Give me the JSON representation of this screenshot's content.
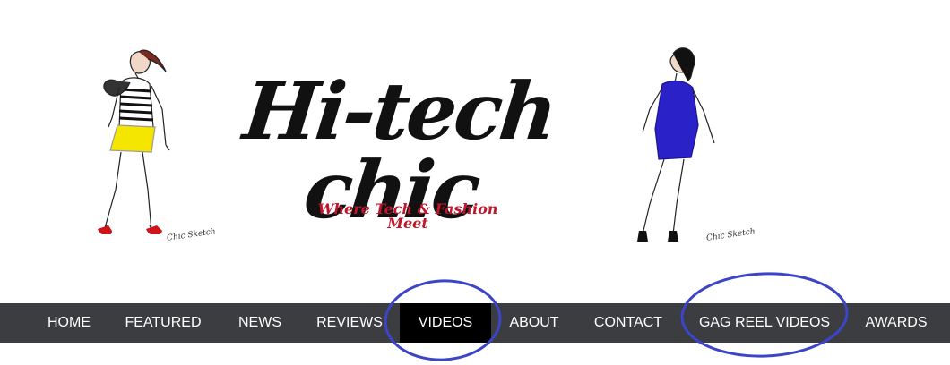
{
  "banner": {
    "title": "Hi-tech chic",
    "tagline": "Where Tech & Fashion Meet",
    "signature": "Chic Sketch"
  },
  "nav": {
    "items": [
      {
        "label": "HOME"
      },
      {
        "label": "FEATURED"
      },
      {
        "label": "NEWS"
      },
      {
        "label": "REVIEWS"
      },
      {
        "label": "VIDEOS",
        "active": true
      },
      {
        "label": "ABOUT"
      },
      {
        "label": "CONTACT"
      },
      {
        "label": "GAG REEL VIDEOS"
      },
      {
        "label": "AWARDS"
      }
    ]
  },
  "colors": {
    "nav_bg": "#3b3d40",
    "nav_active_bg": "#000000",
    "tagline": "#c0152a",
    "annotation_circle": "#3c45c8",
    "dress_left_skirt": "#f5e600",
    "dress_right": "#2a22c8",
    "shoes": "#d0121b"
  }
}
